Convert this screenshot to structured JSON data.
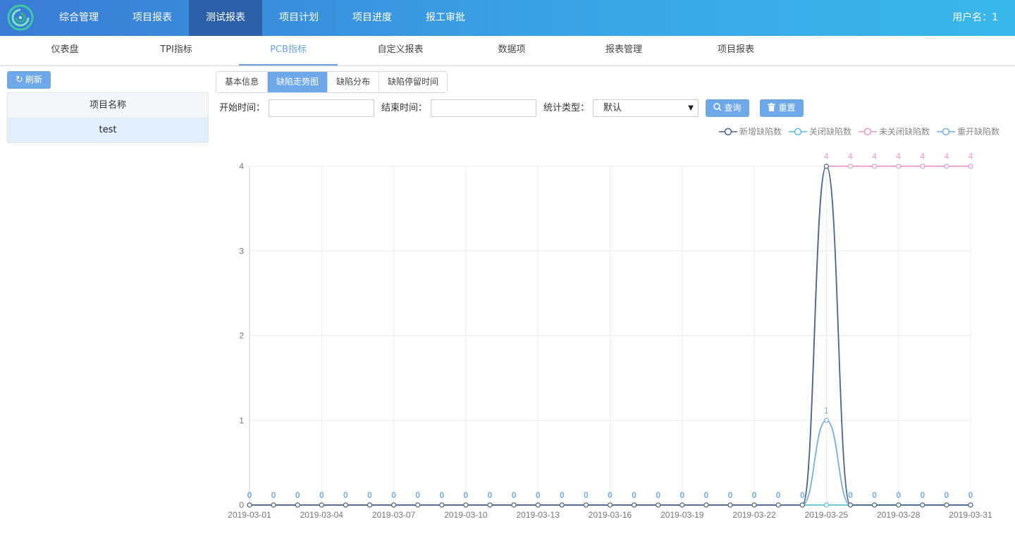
{
  "topbar": {
    "items": [
      "综合管理",
      "项目报表",
      "测试报表",
      "项目计划",
      "项目进度",
      "报工审批"
    ],
    "active_index": 2,
    "user_label": "用户名：1"
  },
  "subnav": {
    "tabs": [
      "仪表盘",
      "TPI指标",
      "PCB指标",
      "自定义报表",
      "数据项",
      "报表管理",
      "项目报表"
    ],
    "active_index": 2
  },
  "left": {
    "refresh_label": "刷新",
    "table_header": "项目名称",
    "rows": [
      "test"
    ]
  },
  "section_tabs": {
    "tabs": [
      "基本信息",
      "缺陷走势图",
      "缺陷分布",
      "缺陷停留时间"
    ],
    "active_index": 1
  },
  "filter": {
    "start_label": "开始时间：",
    "start_value": "",
    "end_label": "结束时间：",
    "end_value": "",
    "type_label": "统计类型：",
    "type_value": "默认",
    "query_label": "查询",
    "reset_label": "重置"
  },
  "colors": {
    "accent": "#6ea8e8",
    "nav_active": "#2b5fa8",
    "series_new": "#4a6587",
    "series_closed": "#5bc0de",
    "series_open": "#e89bcc",
    "series_reopen": "#7aaee0"
  },
  "chart_data": {
    "type": "line",
    "x": [
      "2019-03-01",
      "2019-03-02",
      "2019-03-03",
      "2019-03-04",
      "2019-03-05",
      "2019-03-06",
      "2019-03-07",
      "2019-03-08",
      "2019-03-09",
      "2019-03-10",
      "2019-03-11",
      "2019-03-12",
      "2019-03-13",
      "2019-03-14",
      "2019-03-15",
      "2019-03-16",
      "2019-03-17",
      "2019-03-18",
      "2019-03-19",
      "2019-03-20",
      "2019-03-21",
      "2019-03-22",
      "2019-03-23",
      "2019-03-24",
      "2019-03-25",
      "2019-03-26",
      "2019-03-27",
      "2019-03-28",
      "2019-03-29",
      "2019-03-30",
      "2019-03-31"
    ],
    "x_tick_labels": [
      "2019-03-01",
      "2019-03-04",
      "2019-03-07",
      "2019-03-10",
      "2019-03-13",
      "2019-03-16",
      "2019-03-19",
      "2019-03-22",
      "2019-03-25",
      "2019-03-28",
      "2019-03-31"
    ],
    "ylim": [
      0,
      4
    ],
    "y_ticks": [
      0,
      1,
      2,
      3,
      4
    ],
    "grid": true,
    "legend_position": "top-right",
    "smooth": true,
    "series": [
      {
        "name": "新增缺陷数",
        "color": "#4a6587",
        "values": [
          0,
          0,
          0,
          0,
          0,
          0,
          0,
          0,
          0,
          0,
          0,
          0,
          0,
          0,
          0,
          0,
          0,
          0,
          0,
          0,
          0,
          0,
          0,
          0,
          4,
          0,
          0,
          0,
          0,
          0,
          0
        ],
        "show_labels": false
      },
      {
        "name": "关闭缺陷数",
        "color": "#5bc0de",
        "values": [
          0,
          0,
          0,
          0,
          0,
          0,
          0,
          0,
          0,
          0,
          0,
          0,
          0,
          0,
          0,
          0,
          0,
          0,
          0,
          0,
          0,
          0,
          0,
          0,
          0,
          0,
          0,
          0,
          0,
          0,
          0
        ],
        "show_labels": false
      },
      {
        "name": "未关闭缺陷数",
        "color": "#e89bcc",
        "values": [
          0,
          0,
          0,
          0,
          0,
          0,
          0,
          0,
          0,
          0,
          0,
          0,
          0,
          0,
          0,
          0,
          0,
          0,
          0,
          0,
          0,
          0,
          0,
          0,
          4,
          4,
          4,
          4,
          4,
          4,
          4
        ],
        "show_labels": true
      },
      {
        "name": "重开缺陷数",
        "color": "#7aaee0",
        "values": [
          0,
          0,
          0,
          0,
          0,
          0,
          0,
          0,
          0,
          0,
          0,
          0,
          0,
          0,
          0,
          0,
          0,
          0,
          0,
          0,
          0,
          0,
          0,
          0,
          1,
          0,
          0,
          0,
          0,
          0,
          0
        ],
        "show_labels": true
      }
    ]
  }
}
